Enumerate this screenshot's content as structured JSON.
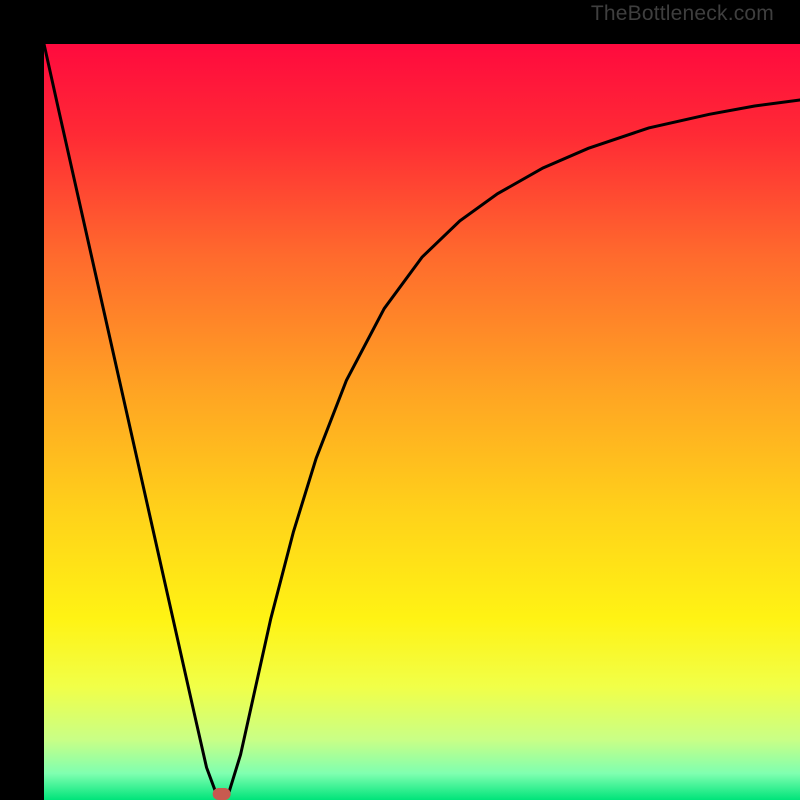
{
  "watermark": "TheBottleneck.com",
  "colors": {
    "border": "#000000",
    "curve": "#000000",
    "marker": "#c85a4f",
    "gradient_stops": [
      {
        "offset": 0.0,
        "color": "#ff0a3e"
      },
      {
        "offset": 0.12,
        "color": "#ff2a35"
      },
      {
        "offset": 0.28,
        "color": "#ff6a2d"
      },
      {
        "offset": 0.46,
        "color": "#ffa423"
      },
      {
        "offset": 0.62,
        "color": "#ffd21a"
      },
      {
        "offset": 0.76,
        "color": "#fff314"
      },
      {
        "offset": 0.85,
        "color": "#f1ff48"
      },
      {
        "offset": 0.92,
        "color": "#c9ff86"
      },
      {
        "offset": 0.965,
        "color": "#7fffb0"
      },
      {
        "offset": 1.0,
        "color": "#00e47a"
      }
    ]
  },
  "chart_data": {
    "type": "line",
    "title": "",
    "xlabel": "",
    "ylabel": "",
    "xlim": [
      0,
      1
    ],
    "ylim": [
      0,
      1
    ],
    "marker": {
      "x": 0.235,
      "y": 0.008
    },
    "series": [
      {
        "name": "left-branch",
        "x": [
          0.0,
          0.02,
          0.04,
          0.06,
          0.08,
          0.1,
          0.12,
          0.14,
          0.16,
          0.18,
          0.2,
          0.215,
          0.228
        ],
        "y": [
          1.0,
          0.91,
          0.821,
          0.732,
          0.643,
          0.554,
          0.465,
          0.376,
          0.287,
          0.198,
          0.109,
          0.043,
          0.008
        ]
      },
      {
        "name": "right-branch",
        "x": [
          0.244,
          0.26,
          0.28,
          0.3,
          0.33,
          0.36,
          0.4,
          0.45,
          0.5,
          0.55,
          0.6,
          0.66,
          0.72,
          0.8,
          0.88,
          0.94,
          1.0
        ],
        "y": [
          0.008,
          0.06,
          0.15,
          0.24,
          0.355,
          0.452,
          0.555,
          0.65,
          0.718,
          0.766,
          0.802,
          0.836,
          0.862,
          0.889,
          0.907,
          0.918,
          0.926
        ]
      }
    ]
  }
}
